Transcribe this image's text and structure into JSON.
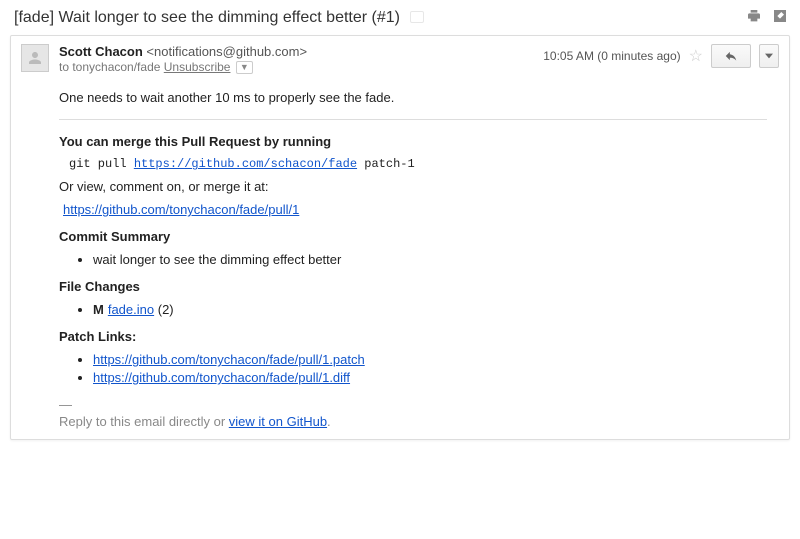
{
  "subject": "[fade] Wait longer to see the dimming effect better (#1)",
  "from": {
    "name": "Scott Chacon",
    "email": "<notifications@github.com>"
  },
  "to_line": {
    "prefix": "to ",
    "recipient": "tonychacon/fade",
    "unsubscribe": "Unsubscribe"
  },
  "timestamp": "10:05 AM (0 minutes ago)",
  "intro": "One needs to wait another 10 ms to properly see the fade.",
  "merge": {
    "heading": "You can merge this Pull Request by running",
    "cmd_prefix": "git pull ",
    "cmd_url": "https://github.com/schacon/fade",
    "cmd_suffix": " patch-1",
    "or_line": "Or view, comment on, or merge it at:",
    "pr_url": "https://github.com/tonychacon/fade/pull/1"
  },
  "commit_summary": {
    "heading": "Commit Summary",
    "items": [
      "wait longer to see the dimming effect better"
    ]
  },
  "file_changes": {
    "heading": "File Changes",
    "items": [
      {
        "flag": "M",
        "file": "fade.ino",
        "count": "(2)"
      }
    ]
  },
  "patch_links": {
    "heading": "Patch Links:",
    "urls": [
      "https://github.com/tonychacon/fade/pull/1.patch",
      "https://github.com/tonychacon/fade/pull/1.diff"
    ]
  },
  "footer": {
    "dashes": "—",
    "prefix": "Reply to this email directly or ",
    "link_text": "view it on GitHub",
    "suffix": "."
  }
}
